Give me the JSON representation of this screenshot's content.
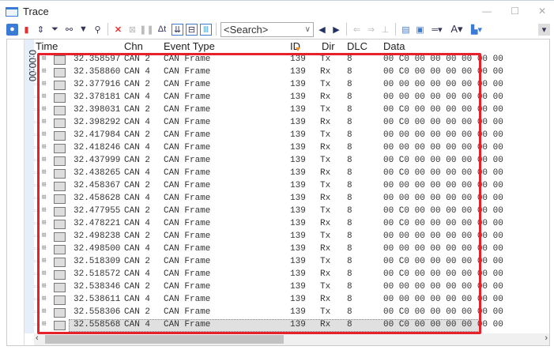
{
  "window": {
    "title": "Trace",
    "minimize": "—",
    "maximize": "☐",
    "close": "✕"
  },
  "toolbar": {
    "search_placeholder": "<Search>",
    "delta_time_label": "Δt"
  },
  "timeline": {
    "label": "0:00:00"
  },
  "columns": [
    "Time",
    "Chn",
    "Event Type",
    "ID",
    "Dir",
    "DLC",
    "Data"
  ],
  "rows": [
    {
      "time": "32.358597",
      "chn": "CAN 2",
      "type": "CAN Frame",
      "id": "139",
      "dir": "Tx",
      "dlc": "8",
      "data": "00 C0 00 00 00 00 00 00"
    },
    {
      "time": "32.358860",
      "chn": "CAN 4",
      "type": "CAN Frame",
      "id": "139",
      "dir": "Rx",
      "dlc": "8",
      "data": "00 C0 00 00 00 00 00 00"
    },
    {
      "time": "32.377916",
      "chn": "CAN 2",
      "type": "CAN Frame",
      "id": "139",
      "dir": "Tx",
      "dlc": "8",
      "data": "00 00 00 00 00 00 00 00"
    },
    {
      "time": "32.378181",
      "chn": "CAN 4",
      "type": "CAN Frame",
      "id": "139",
      "dir": "Rx",
      "dlc": "8",
      "data": "00 00 00 00 00 00 00 00"
    },
    {
      "time": "32.398031",
      "chn": "CAN 2",
      "type": "CAN Frame",
      "id": "139",
      "dir": "Tx",
      "dlc": "8",
      "data": "00 C0 00 00 00 00 00 00"
    },
    {
      "time": "32.398292",
      "chn": "CAN 4",
      "type": "CAN Frame",
      "id": "139",
      "dir": "Rx",
      "dlc": "8",
      "data": "00 C0 00 00 00 00 00 00"
    },
    {
      "time": "32.417984",
      "chn": "CAN 2",
      "type": "CAN Frame",
      "id": "139",
      "dir": "Tx",
      "dlc": "8",
      "data": "00 00 00 00 00 00 00 00"
    },
    {
      "time": "32.418246",
      "chn": "CAN 4",
      "type": "CAN Frame",
      "id": "139",
      "dir": "Rx",
      "dlc": "8",
      "data": "00 00 00 00 00 00 00 00"
    },
    {
      "time": "32.437999",
      "chn": "CAN 2",
      "type": "CAN Frame",
      "id": "139",
      "dir": "Tx",
      "dlc": "8",
      "data": "00 C0 00 00 00 00 00 00"
    },
    {
      "time": "32.438265",
      "chn": "CAN 4",
      "type": "CAN Frame",
      "id": "139",
      "dir": "Rx",
      "dlc": "8",
      "data": "00 C0 00 00 00 00 00 00"
    },
    {
      "time": "32.458367",
      "chn": "CAN 2",
      "type": "CAN Frame",
      "id": "139",
      "dir": "Tx",
      "dlc": "8",
      "data": "00 00 00 00 00 00 00 00"
    },
    {
      "time": "32.458628",
      "chn": "CAN 4",
      "type": "CAN Frame",
      "id": "139",
      "dir": "Rx",
      "dlc": "8",
      "data": "00 00 00 00 00 00 00 00"
    },
    {
      "time": "32.477955",
      "chn": "CAN 2",
      "type": "CAN Frame",
      "id": "139",
      "dir": "Tx",
      "dlc": "8",
      "data": "00 C0 00 00 00 00 00 00"
    },
    {
      "time": "32.478221",
      "chn": "CAN 4",
      "type": "CAN Frame",
      "id": "139",
      "dir": "Rx",
      "dlc": "8",
      "data": "00 C0 00 00 00 00 00 00"
    },
    {
      "time": "32.498238",
      "chn": "CAN 2",
      "type": "CAN Frame",
      "id": "139",
      "dir": "Tx",
      "dlc": "8",
      "data": "00 00 00 00 00 00 00 00"
    },
    {
      "time": "32.498500",
      "chn": "CAN 4",
      "type": "CAN Frame",
      "id": "139",
      "dir": "Rx",
      "dlc": "8",
      "data": "00 00 00 00 00 00 00 00"
    },
    {
      "time": "32.518309",
      "chn": "CAN 2",
      "type": "CAN Frame",
      "id": "139",
      "dir": "Tx",
      "dlc": "8",
      "data": "00 C0 00 00 00 00 00 00"
    },
    {
      "time": "32.518572",
      "chn": "CAN 4",
      "type": "CAN Frame",
      "id": "139",
      "dir": "Rx",
      "dlc": "8",
      "data": "00 C0 00 00 00 00 00 00"
    },
    {
      "time": "32.538346",
      "chn": "CAN 2",
      "type": "CAN Frame",
      "id": "139",
      "dir": "Tx",
      "dlc": "8",
      "data": "00 00 00 00 00 00 00 00"
    },
    {
      "time": "32.538611",
      "chn": "CAN 4",
      "type": "CAN Frame",
      "id": "139",
      "dir": "Rx",
      "dlc": "8",
      "data": "00 00 00 00 00 00 00 00"
    },
    {
      "time": "32.558306",
      "chn": "CAN 2",
      "type": "CAN Frame",
      "id": "139",
      "dir": "Tx",
      "dlc": "8",
      "data": "00 C0 00 00 00 00 00 00"
    },
    {
      "time": "32.558568",
      "chn": "CAN 4",
      "type": "CAN Frame",
      "id": "139",
      "dir": "Rx",
      "dlc": "8",
      "data": "00 C0 00 00 00 00 00 00",
      "selected": true
    }
  ],
  "colors": {
    "highlight_box": "#e8202a",
    "sort_indicator": "#f39020",
    "selected_row": "#e0e0e0"
  }
}
